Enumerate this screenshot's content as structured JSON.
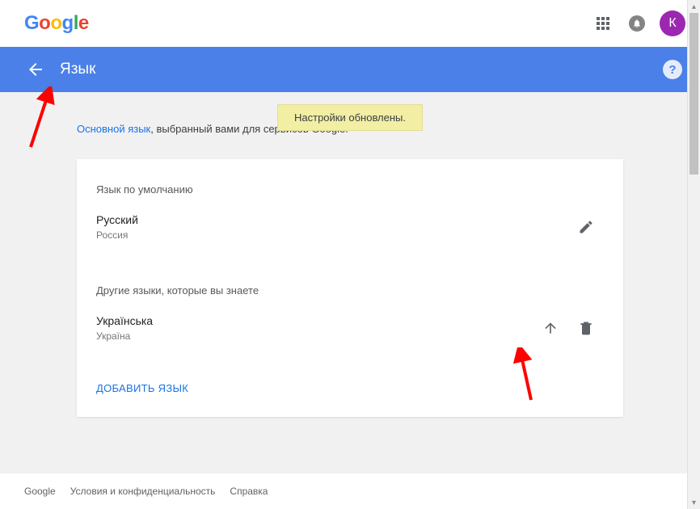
{
  "logo_text": "Google",
  "avatar_initial": "К",
  "bluebar": {
    "title": "Язык"
  },
  "toast": {
    "message": "Настройки обновлены."
  },
  "intro": {
    "link_text": "Основной язык",
    "rest_text": ", выбранный вами для сервисов Google."
  },
  "card": {
    "default_section_label": "Язык по умолчанию",
    "default_lang": {
      "name": "Русский",
      "region": "Россия"
    },
    "other_section_label": "Другие языки, которые вы знаете",
    "other_langs": [
      {
        "name": "Українська",
        "region": "Україна"
      }
    ],
    "add_lang_label": "ДОБАВИТЬ ЯЗЫК"
  },
  "footer": {
    "brand": "Google",
    "privacy": "Условия и конфиденциальность",
    "help": "Справка"
  }
}
